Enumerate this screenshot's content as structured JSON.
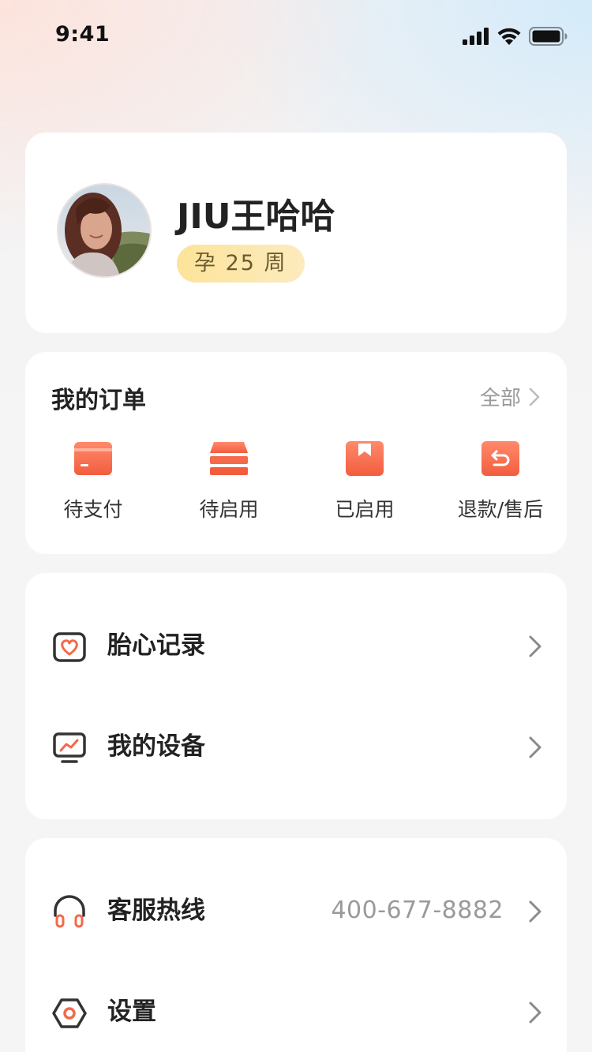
{
  "status_bar": {
    "time": "9:41",
    "icons": [
      "signal-icon",
      "wifi-icon",
      "battery-icon"
    ]
  },
  "profile": {
    "name": "JIU王哈哈",
    "pregnancy_badge": "孕 25 周"
  },
  "orders": {
    "title": "我的订单",
    "view_all": "全部",
    "items": [
      {
        "label": "待支付",
        "icon": "card-icon"
      },
      {
        "label": "待启用",
        "icon": "stack-icon"
      },
      {
        "label": "已启用",
        "icon": "bookmark-icon"
      },
      {
        "label": "退款/售后",
        "icon": "return-icon"
      }
    ]
  },
  "menu_group_1": [
    {
      "label": "胎心记录",
      "icon": "heart-record-icon"
    },
    {
      "label": "我的设备",
      "icon": "monitor-icon"
    }
  ],
  "menu_group_2": [
    {
      "label": "客服热线",
      "icon": "headphones-icon",
      "value": "400-677-8882"
    },
    {
      "label": "设置",
      "icon": "settings-hexagon-icon"
    }
  ],
  "colors": {
    "accent": "#f26a4a",
    "badge_gradient_start": "#fde39a",
    "badge_gradient_end": "#fcebbd",
    "text_primary": "#222222",
    "text_secondary": "#9a9a9a"
  }
}
